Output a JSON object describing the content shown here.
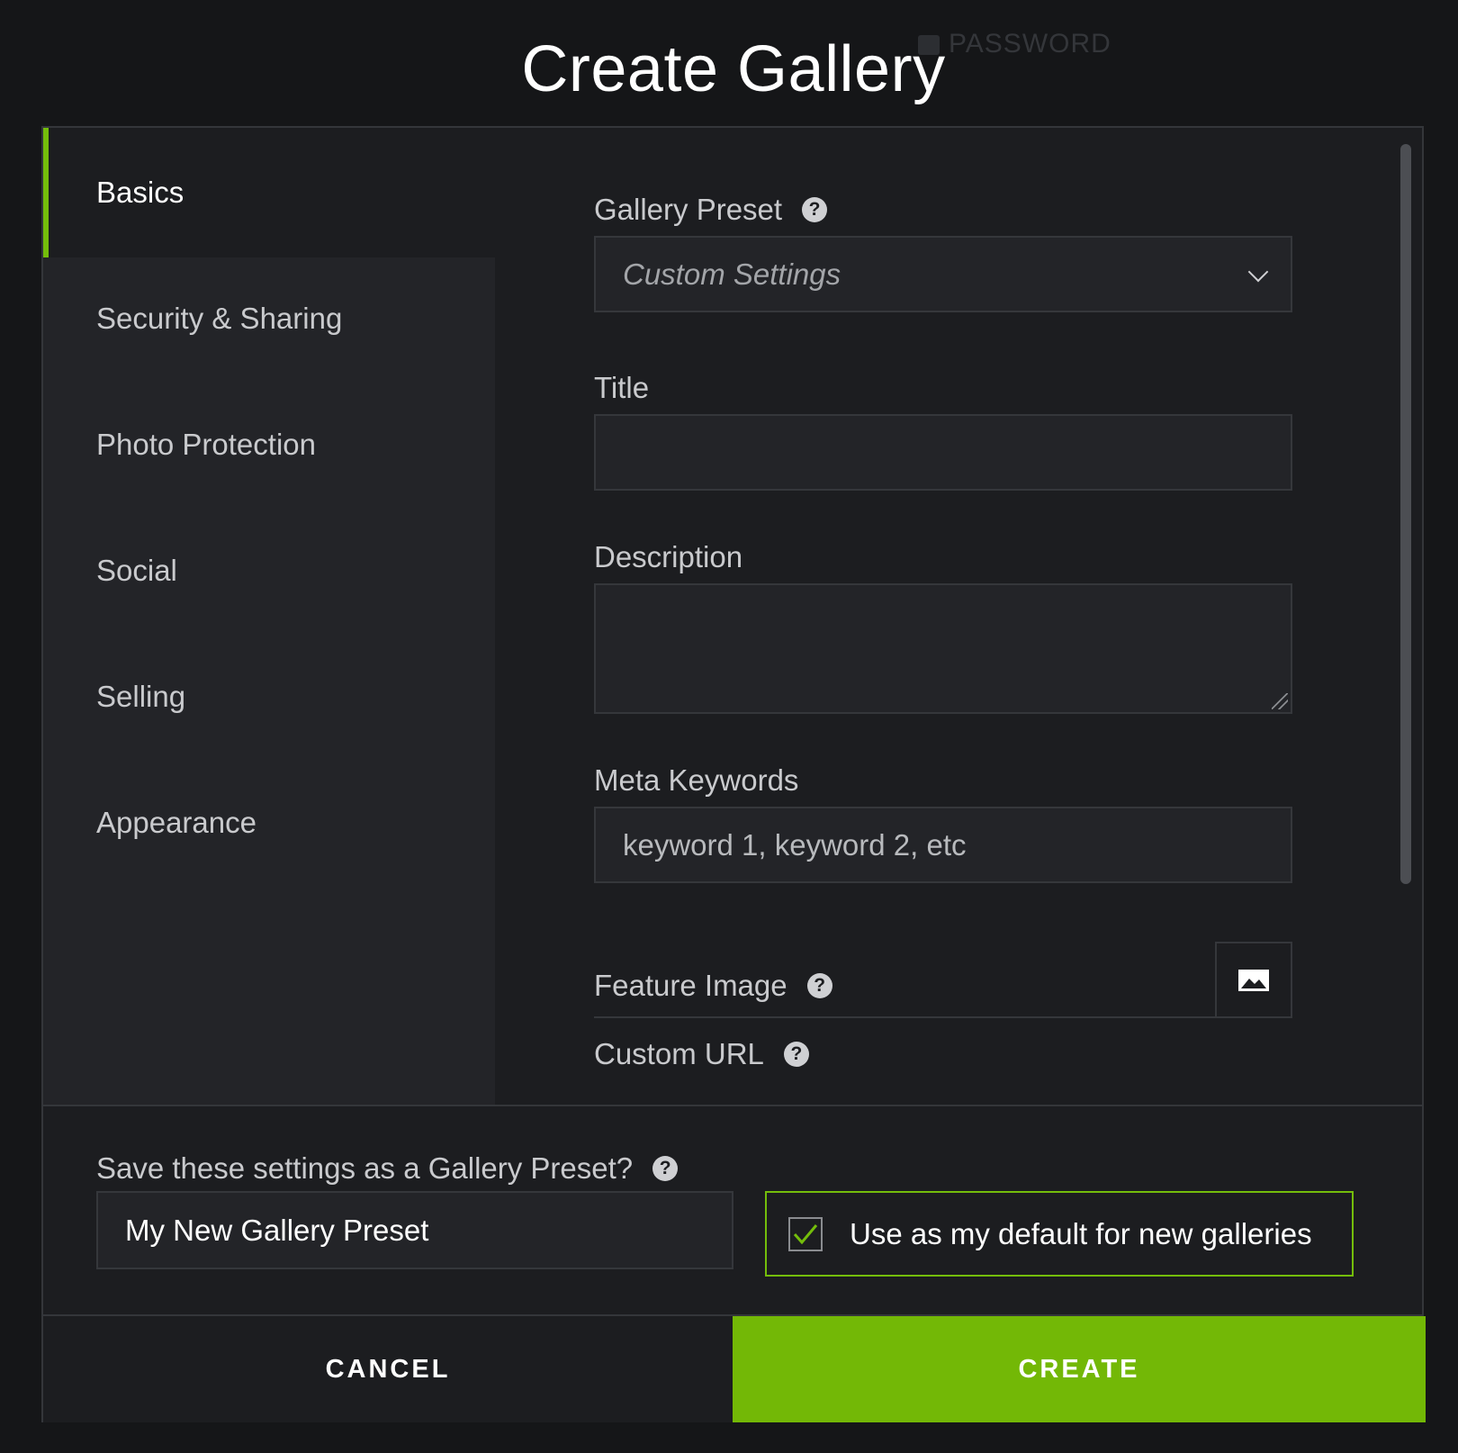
{
  "page": {
    "title": "Create Gallery"
  },
  "background": {
    "password_label": "PASSWORD"
  },
  "sidebar": {
    "items": [
      {
        "label": "Basics"
      },
      {
        "label": "Security & Sharing"
      },
      {
        "label": "Photo Protection"
      },
      {
        "label": "Social"
      },
      {
        "label": "Selling"
      },
      {
        "label": "Appearance"
      }
    ]
  },
  "form": {
    "preset": {
      "label": "Gallery Preset",
      "value": "Custom Settings"
    },
    "title": {
      "label": "Title",
      "value": ""
    },
    "description": {
      "label": "Description",
      "value": ""
    },
    "meta_keywords": {
      "label": "Meta Keywords",
      "placeholder": "keyword 1, keyword 2, etc"
    },
    "feature_image": {
      "label": "Feature Image"
    },
    "custom_url": {
      "label": "Custom URL"
    }
  },
  "footer": {
    "save_preset_label": "Save these settings as a Gallery Preset?",
    "preset_name_value": "My New Gallery Preset",
    "default_label": "Use as my default for new galleries",
    "default_checked": true,
    "cancel_label": "CANCEL",
    "create_label": "CREATE"
  },
  "colors": {
    "accent": "#74bd0b",
    "create_button": "#73b806",
    "modal_bg": "#1c1d20",
    "sidebar_bg": "#232428"
  }
}
